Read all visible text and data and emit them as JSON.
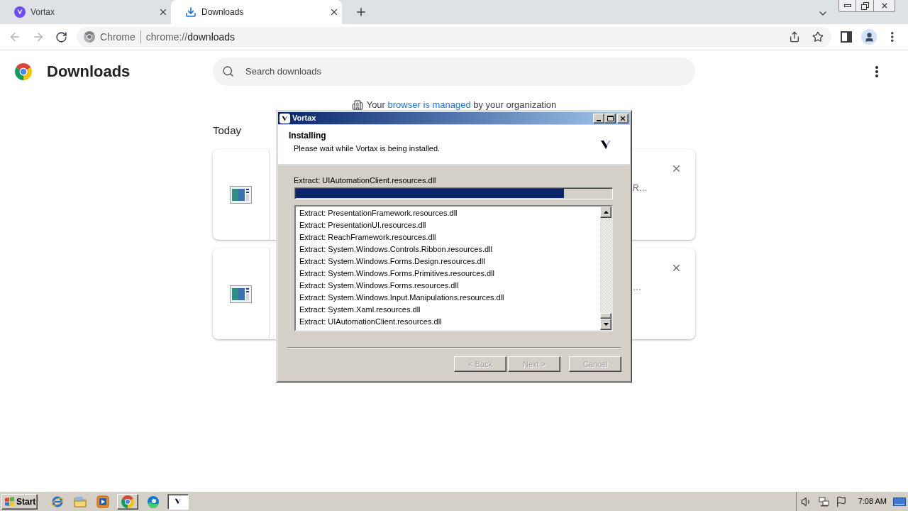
{
  "browser": {
    "tabs": [
      {
        "title": "Vortax",
        "selected": false
      },
      {
        "title": "Downloads",
        "selected": true
      }
    ],
    "address_bar": {
      "chip": "Chrome",
      "url": {
        "scheme": "chrome://",
        "path": "downloads"
      }
    }
  },
  "page": {
    "title": "Downloads",
    "search": {
      "placeholder": "Search downloads"
    },
    "managed_notice": {
      "before": "Your",
      "link": "browser is managed",
      "after": "by your organization"
    },
    "section": "Today",
    "cards": [
      {
        "fragment": "R…"
      },
      {
        "fragment": "…"
      }
    ]
  },
  "installer": {
    "title": "Vortax",
    "heading": "Installing",
    "subheading": "Please wait while Vortax is being installed.",
    "status": "Extract: UIAutomationClient.resources.dll",
    "progress": {
      "level": 0.85
    },
    "log": [
      "Extract: PresentationFramework.resources.dll",
      "Extract: PresentationUI.resources.dll",
      "Extract: ReachFramework.resources.dll",
      "Extract: System.Windows.Controls.Ribbon.resources.dll",
      "Extract: System.Windows.Forms.Design.resources.dll",
      "Extract: System.Windows.Forms.Primitives.resources.dll",
      "Extract: System.Windows.Forms.resources.dll",
      "Extract: System.Windows.Input.Manipulations.resources.dll",
      "Extract: System.Xaml.resources.dll",
      "Extract: UIAutomationClient.resources.dll"
    ],
    "buttons": [
      {
        "label": "< Back",
        "disabled": true
      },
      {
        "label": "Next >",
        "disabled": true
      },
      {
        "label": "Cancel",
        "disabled": true
      }
    ]
  },
  "taskbar": {
    "start": "Start",
    "items": [
      {
        "kind": "ie",
        "selected": false
      },
      {
        "kind": "explorer",
        "selected": false
      },
      {
        "kind": "media",
        "selected": false
      },
      {
        "kind": "chrome",
        "selected": false
      },
      {
        "kind": "edge",
        "selected": false
      },
      {
        "kind": "installer",
        "selected": true
      }
    ],
    "clock": "7:08 AM"
  }
}
